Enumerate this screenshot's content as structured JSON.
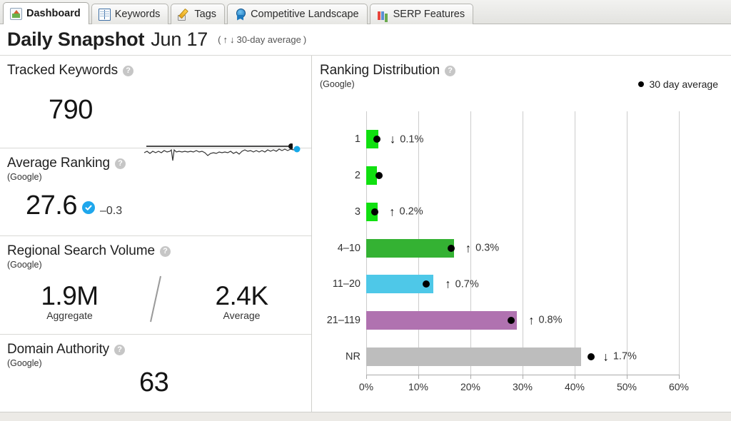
{
  "tabs": [
    {
      "label": "Dashboard",
      "icon": "dashboard-icon",
      "active": true
    },
    {
      "label": "Keywords",
      "icon": "book-icon",
      "active": false
    },
    {
      "label": "Tags",
      "icon": "tag-pencil-icon",
      "active": false
    },
    {
      "label": "Competitive Landscape",
      "icon": "award-ribbon-icon",
      "active": false
    },
    {
      "label": "SERP Features",
      "icon": "bar-chart-icon",
      "active": false
    }
  ],
  "header": {
    "title": "Daily Snapshot",
    "date": "Jun 17",
    "note_open": "(",
    "arrow_up": "↑",
    "arrow_down": "↓",
    "note_text": "30-day average",
    "note_close": ")"
  },
  "help_glyph": "?",
  "panels": {
    "tracked_keywords": {
      "title": "Tracked Keywords",
      "value": "790"
    },
    "average_ranking": {
      "title": "Average Ranking",
      "subtitle": "(Google)",
      "value": "27.6",
      "delta": "–0.3"
    },
    "regional_search_volume": {
      "title": "Regional Search Volume",
      "subtitle": "(Google)",
      "aggregate_value": "1.9M",
      "aggregate_label": "Aggregate",
      "separator": "/",
      "average_value": "2.4K",
      "average_label": "Average"
    },
    "domain_authority": {
      "title": "Domain Authority",
      "subtitle": "(Google)",
      "value": "63"
    }
  },
  "chart_panel": {
    "title": "Ranking Distribution",
    "subtitle": "(Google)",
    "legend_label": "30 day average"
  },
  "chart_data": {
    "type": "bar",
    "orientation": "horizontal",
    "title": "Ranking Distribution",
    "subtitle": "(Google)",
    "xlabel": "",
    "ylabel": "",
    "xlim": [
      0,
      60
    ],
    "xticks": [
      0,
      10,
      20,
      30,
      40,
      50,
      60
    ],
    "xticklabels": [
      "0%",
      "10%",
      "20%",
      "30%",
      "40%",
      "50%",
      "60%"
    ],
    "grid": true,
    "legend": [
      "30 day average"
    ],
    "legend_position": "top-right",
    "categories": [
      "1",
      "2",
      "3",
      "4–10",
      "11–20",
      "21–119",
      "NR"
    ],
    "values": [
      2.3,
      2.0,
      2.2,
      16.8,
      12.9,
      28.9,
      41.2
    ],
    "colors": [
      "#10e010",
      "#10e010",
      "#10e010",
      "#34b233",
      "#4ec8e8",
      "#b072b0",
      "#bdbdbd"
    ],
    "average_markers": [
      2.1,
      2.4,
      1.6,
      16.3,
      11.5,
      27.8,
      43.2
    ],
    "change_labels": [
      "0.1%",
      "",
      "0.2%",
      "0.3%",
      "0.7%",
      "0.8%",
      "1.7%"
    ],
    "change_directions": [
      "down",
      "",
      "up",
      "up",
      "up",
      "up",
      "down"
    ],
    "arrow_up_glyph": "↑",
    "arrow_down_glyph": "↓"
  }
}
